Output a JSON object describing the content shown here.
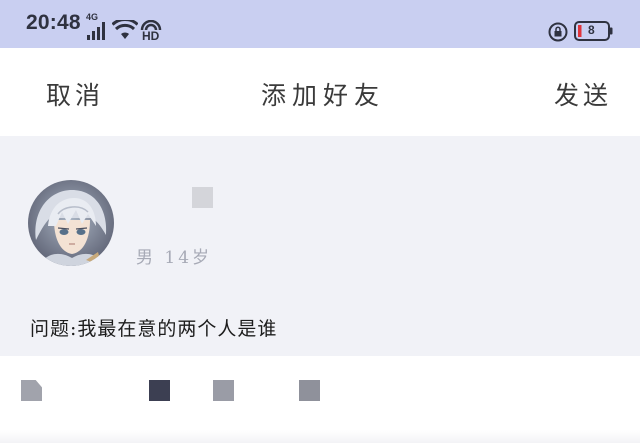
{
  "status_bar": {
    "time": "20:48",
    "network": "4G",
    "hd": "HD",
    "battery_level": "8",
    "background_color": "#c9cff1",
    "icons": [
      "signal-icon",
      "wifi-icon",
      "hd-icon",
      "rotation-lock-icon",
      "battery-icon"
    ]
  },
  "nav": {
    "cancel_label": "取消",
    "title": "添加好友",
    "send_label": "发送"
  },
  "profile": {
    "gender_age": "男 14岁",
    "question": "问题:我最在意的两个人是谁"
  },
  "colors": {
    "battery_low": "#e0333a",
    "page_background": "#f1f2f7"
  }
}
